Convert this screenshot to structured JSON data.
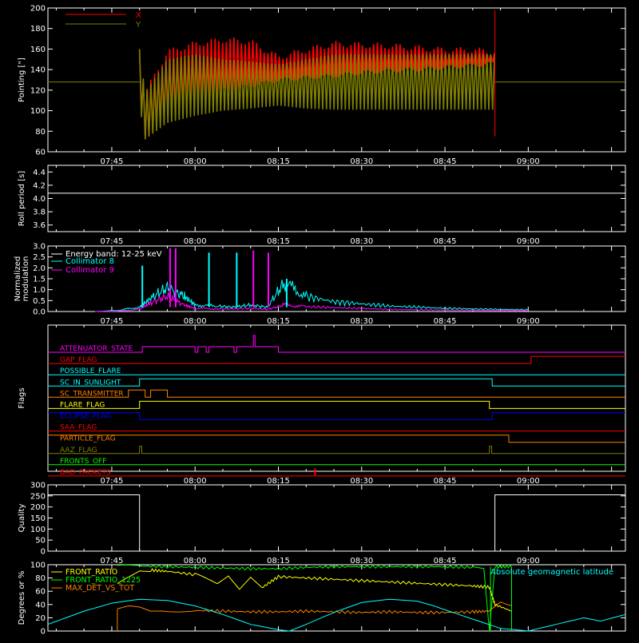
{
  "time_labels": [
    "07:45",
    "08:00",
    "08:15",
    "08:30",
    "08:45",
    "09:00"
  ],
  "time_minutes": [
    465,
    480,
    495,
    510,
    525,
    540
  ],
  "time_range": [
    453.5,
    557.5
  ],
  "chart_data": [
    {
      "id": "pointing",
      "type": "line",
      "ylabel": "Pointing [\"]",
      "ylim": [
        60,
        200
      ],
      "yticks": [
        "60",
        "80",
        "100",
        "120",
        "140",
        "160",
        "180",
        "200"
      ],
      "yvalues": [
        60,
        80,
        100,
        120,
        140,
        160,
        180,
        200
      ],
      "legend": "top-left",
      "series": [
        {
          "name": "X",
          "color": "#ff0000",
          "envelope_x": [
            470,
            471,
            475,
            480,
            485,
            490,
            495,
            500,
            505,
            510,
            515,
            520,
            525,
            530,
            534
          ],
          "envelope_max": [
            165,
            120,
            160,
            168,
            172,
            170,
            155,
            162,
            168,
            167,
            166,
            164,
            162,
            162,
            160
          ],
          "envelope_min": [
            110,
            70,
            95,
            110,
            118,
            122,
            128,
            130,
            132,
            135,
            137,
            138,
            140,
            142,
            144
          ]
        },
        {
          "name": "Y",
          "color": "#808000",
          "envelope_x": [
            470,
            471,
            475,
            480,
            485,
            490,
            495,
            500,
            505,
            510,
            515,
            520,
            525,
            530,
            534
          ],
          "envelope_max": [
            160,
            118,
            150,
            155,
            150,
            148,
            145,
            150,
            155,
            155,
            155,
            155,
            155,
            155,
            155
          ],
          "envelope_min": [
            105,
            72,
            88,
            95,
            100,
            102,
            105,
            102,
            101,
            101,
            101,
            101,
            101,
            101,
            101
          ],
          "baseline": 128
        }
      ]
    },
    {
      "id": "roll",
      "type": "line",
      "ylabel": "Roll period [s]",
      "ylim": [
        3.5,
        4.5
      ],
      "yticks": [
        "3.6",
        "3.8",
        "4.0",
        "4.2",
        "4.4"
      ],
      "yvalues": [
        3.6,
        3.8,
        4.0,
        4.2,
        4.4
      ],
      "series": [
        {
          "name": "",
          "color": "#ffffff",
          "value": 4.08
        }
      ]
    },
    {
      "id": "modulation",
      "type": "line",
      "ylabel": "Normalized modulation",
      "ylim": [
        0,
        3
      ],
      "yticks": [
        "0.0",
        "0.5",
        "1.0",
        "1.5",
        "2.0",
        "2.5",
        "3.0"
      ],
      "yvalues": [
        0,
        0.5,
        1,
        1.5,
        2,
        2.5,
        3
      ],
      "legend_title": "Energy band: 12-25 keV",
      "series": [
        {
          "name": "Collimator 8",
          "color": "#00ffff",
          "x": [
            462,
            466,
            470,
            472,
            475,
            478,
            480,
            484,
            487,
            490,
            493,
            496,
            500,
            505,
            510,
            515,
            520,
            525,
            530,
            535,
            540
          ],
          "y": [
            0,
            0.05,
            0.2,
            0.6,
            1.1,
            0.7,
            0.3,
            0.25,
            0.2,
            0.3,
            0.2,
            1.3,
            0.7,
            0.45,
            0.35,
            0.25,
            0.2,
            0.15,
            0.12,
            0.1,
            0.08
          ]
        },
        {
          "name": "Collimator 9",
          "color": "#ff00ff",
          "x": [
            462,
            466,
            470,
            472,
            475,
            478,
            480,
            484,
            487,
            490,
            493,
            496,
            500,
            505,
            510,
            515,
            520,
            525,
            530,
            535,
            540
          ],
          "y": [
            0,
            0.02,
            0.1,
            0.4,
            0.7,
            0.3,
            0.15,
            0.12,
            0.12,
            0.15,
            0.1,
            0.3,
            0.22,
            0.18,
            0.14,
            0.1,
            0.08,
            0.07,
            0.06,
            0.05,
            0.04
          ]
        }
      ],
      "spikes": [
        {
          "x": 470.5,
          "h": 2.1,
          "color": "#00ffff"
        },
        {
          "x": 475.5,
          "h": 2.9,
          "color": "#ff00ff"
        },
        {
          "x": 476.5,
          "h": 2.9,
          "color": "#ff00ff"
        },
        {
          "x": 482.5,
          "h": 2.7,
          "color": "#00ffff"
        },
        {
          "x": 487.5,
          "h": 2.7,
          "color": "#00ffff"
        },
        {
          "x": 490.5,
          "h": 2.8,
          "color": "#ff00ff"
        },
        {
          "x": 493.2,
          "h": 2.7,
          "color": "#ff00ff"
        },
        {
          "x": 496.5,
          "h": 1.5,
          "color": "#00ffff"
        }
      ]
    },
    {
      "id": "flags",
      "type": "table",
      "ylabel": "Flags",
      "flags": [
        {
          "name": "ATTENUATOR_STATE",
          "color": "#ff00ff",
          "segments": [
            [
              453.5,
              470.5,
              0
            ],
            [
              470.5,
              480,
              1
            ],
            [
              480,
              480.5,
              0
            ],
            [
              480.5,
              482,
              1
            ],
            [
              482,
              482.5,
              0
            ],
            [
              482.5,
              487,
              1
            ],
            [
              487,
              487.5,
              0
            ],
            [
              487.5,
              490.5,
              1
            ],
            [
              490.5,
              490.8,
              3
            ],
            [
              490.8,
              495,
              1
            ],
            [
              495,
              557.5,
              0
            ]
          ]
        },
        {
          "name": "GAP_FLAG",
          "color": "#ff0000",
          "segments": [
            [
              453.5,
              540.5,
              0
            ],
            [
              540.5,
              557.5,
              1
            ]
          ]
        },
        {
          "name": "POSSIBLE_FLARE",
          "color": "#00ffff",
          "segments": [
            [
              453.5,
              557.5,
              0
            ]
          ]
        },
        {
          "name": "SC_IN_SUNLIGHT",
          "color": "#00ffff",
          "segments": [
            [
              453.5,
              470,
              0
            ],
            [
              470,
              533.5,
              1
            ],
            [
              533.5,
              557.5,
              0
            ]
          ]
        },
        {
          "name": "SC_TRANSMITTER",
          "color": "#ff8000",
          "segments": [
            [
              453.5,
              468,
              0
            ],
            [
              468,
              471,
              1
            ],
            [
              471,
              472,
              0
            ],
            [
              472,
              475,
              1
            ],
            [
              475,
              476,
              0
            ],
            [
              476,
              557.5,
              0
            ]
          ]
        },
        {
          "name": "FLARE_FLAG",
          "color": "#ffff00",
          "segments": [
            [
              453.5,
              470,
              0
            ],
            [
              470,
              533,
              1
            ],
            [
              533,
              557.5,
              0
            ]
          ]
        },
        {
          "name": "ECLIPSE_FLAG",
          "color": "#0000ff",
          "segments": [
            [
              453.5,
              470,
              1
            ],
            [
              470,
              533.5,
              0
            ],
            [
              533.5,
              557.5,
              1
            ]
          ]
        },
        {
          "name": "SAA_FLAG",
          "color": "#ff0000",
          "segments": [
            [
              453.5,
              557.5,
              0
            ]
          ]
        },
        {
          "name": "PARTICLE_FLAG",
          "color": "#ff8000",
          "segments": [
            [
              453.5,
              467,
              1
            ],
            [
              467,
              536.5,
              1
            ],
            [
              536.5,
              557.5,
              0
            ]
          ]
        },
        {
          "name": "AAZ_FLAG",
          "color": "#808000",
          "segments": [
            [
              453.5,
              470,
              0
            ],
            [
              470,
              470.4,
              1
            ],
            [
              470.4,
              533,
              0
            ],
            [
              533,
              533.4,
              1
            ],
            [
              533.4,
              557.5,
              0
            ]
          ]
        },
        {
          "name": "FRONTS_OFF",
          "color": "#00ff00",
          "segments": [
            [
              453.5,
              557.5,
              0
            ]
          ]
        },
        {
          "name": "BAD_PACKETS",
          "color": "#ff0000",
          "segments": [
            [
              453.5,
              501.5,
              0
            ],
            [
              501.5,
              501.7,
              1
            ],
            [
              501.7,
              557.5,
              0
            ]
          ]
        }
      ]
    },
    {
      "id": "quality",
      "type": "line",
      "ylabel": "Quality",
      "ylim": [
        0,
        300
      ],
      "yticks": [
        "0",
        "50",
        "100",
        "150",
        "200",
        "250",
        "300"
      ],
      "yvalues": [
        0,
        50,
        100,
        150,
        200,
        250,
        300
      ],
      "series": [
        {
          "name": "",
          "color": "#ffffff",
          "x": [
            453.5,
            470,
            470,
            534,
            534,
            557.5
          ],
          "y": [
            255,
            255,
            0,
            0,
            255,
            255
          ]
        }
      ]
    },
    {
      "id": "ratios",
      "type": "line",
      "ylabel": "Degrees or %",
      "ylim": [
        0,
        100
      ],
      "yticks": [
        "0",
        "20",
        "40",
        "60",
        "80",
        "100"
      ],
      "yvalues": [
        0,
        20,
        40,
        60,
        80,
        100
      ],
      "annotation": {
        "text": "Absolute geomagnetic latitude",
        "color": "#00ffff"
      },
      "series": [
        {
          "name": "FRONT_RATIO",
          "color": "#ffff00",
          "x": [
            466,
            470,
            472,
            475,
            480,
            484,
            486,
            488,
            490,
            492,
            495,
            500,
            505,
            510,
            515,
            520,
            525,
            530,
            533,
            534,
            537
          ],
          "y": [
            70,
            92,
            92,
            90,
            85,
            72,
            85,
            65,
            82,
            65,
            82,
            80,
            78,
            76,
            74,
            72,
            70,
            68,
            66,
            40,
            30
          ]
        },
        {
          "name": "FRONT_RATIO_1225",
          "color": "#00ff00",
          "x": [
            466,
            470,
            475,
            480,
            485,
            490,
            495,
            500,
            505,
            510,
            515,
            520,
            525,
            530,
            532,
            533,
            534,
            537
          ],
          "y": [
            97,
            98,
            97,
            96,
            95,
            94,
            94,
            96,
            97,
            97,
            97,
            97,
            97,
            96,
            95,
            0,
            97,
            97
          ]
        },
        {
          "name": "MAX_DET_VS_TOT",
          "color": "#ff8000",
          "x": [
            466,
            468,
            470,
            472,
            474,
            480,
            485,
            490,
            495,
            500,
            505,
            510,
            515,
            520,
            525,
            530,
            533,
            535,
            537
          ],
          "y": [
            33,
            36,
            34,
            29,
            31,
            31,
            30,
            29,
            29,
            30,
            29,
            28,
            29,
            28,
            28,
            29,
            30,
            45,
            40
          ]
        },
        {
          "name": "",
          "color": "#00ffff",
          "x": [
            453.5,
            460,
            465,
            470,
            475,
            480,
            485,
            490,
            495,
            497,
            500,
            505,
            510,
            515,
            520,
            523,
            525,
            530,
            535,
            540,
            545,
            550,
            553,
            557.5
          ],
          "y": [
            10,
            30,
            42,
            48,
            46,
            38,
            25,
            10,
            2,
            0,
            10,
            28,
            43,
            48,
            45,
            38,
            32,
            18,
            4,
            0,
            10,
            20,
            15,
            25
          ]
        }
      ]
    }
  ]
}
